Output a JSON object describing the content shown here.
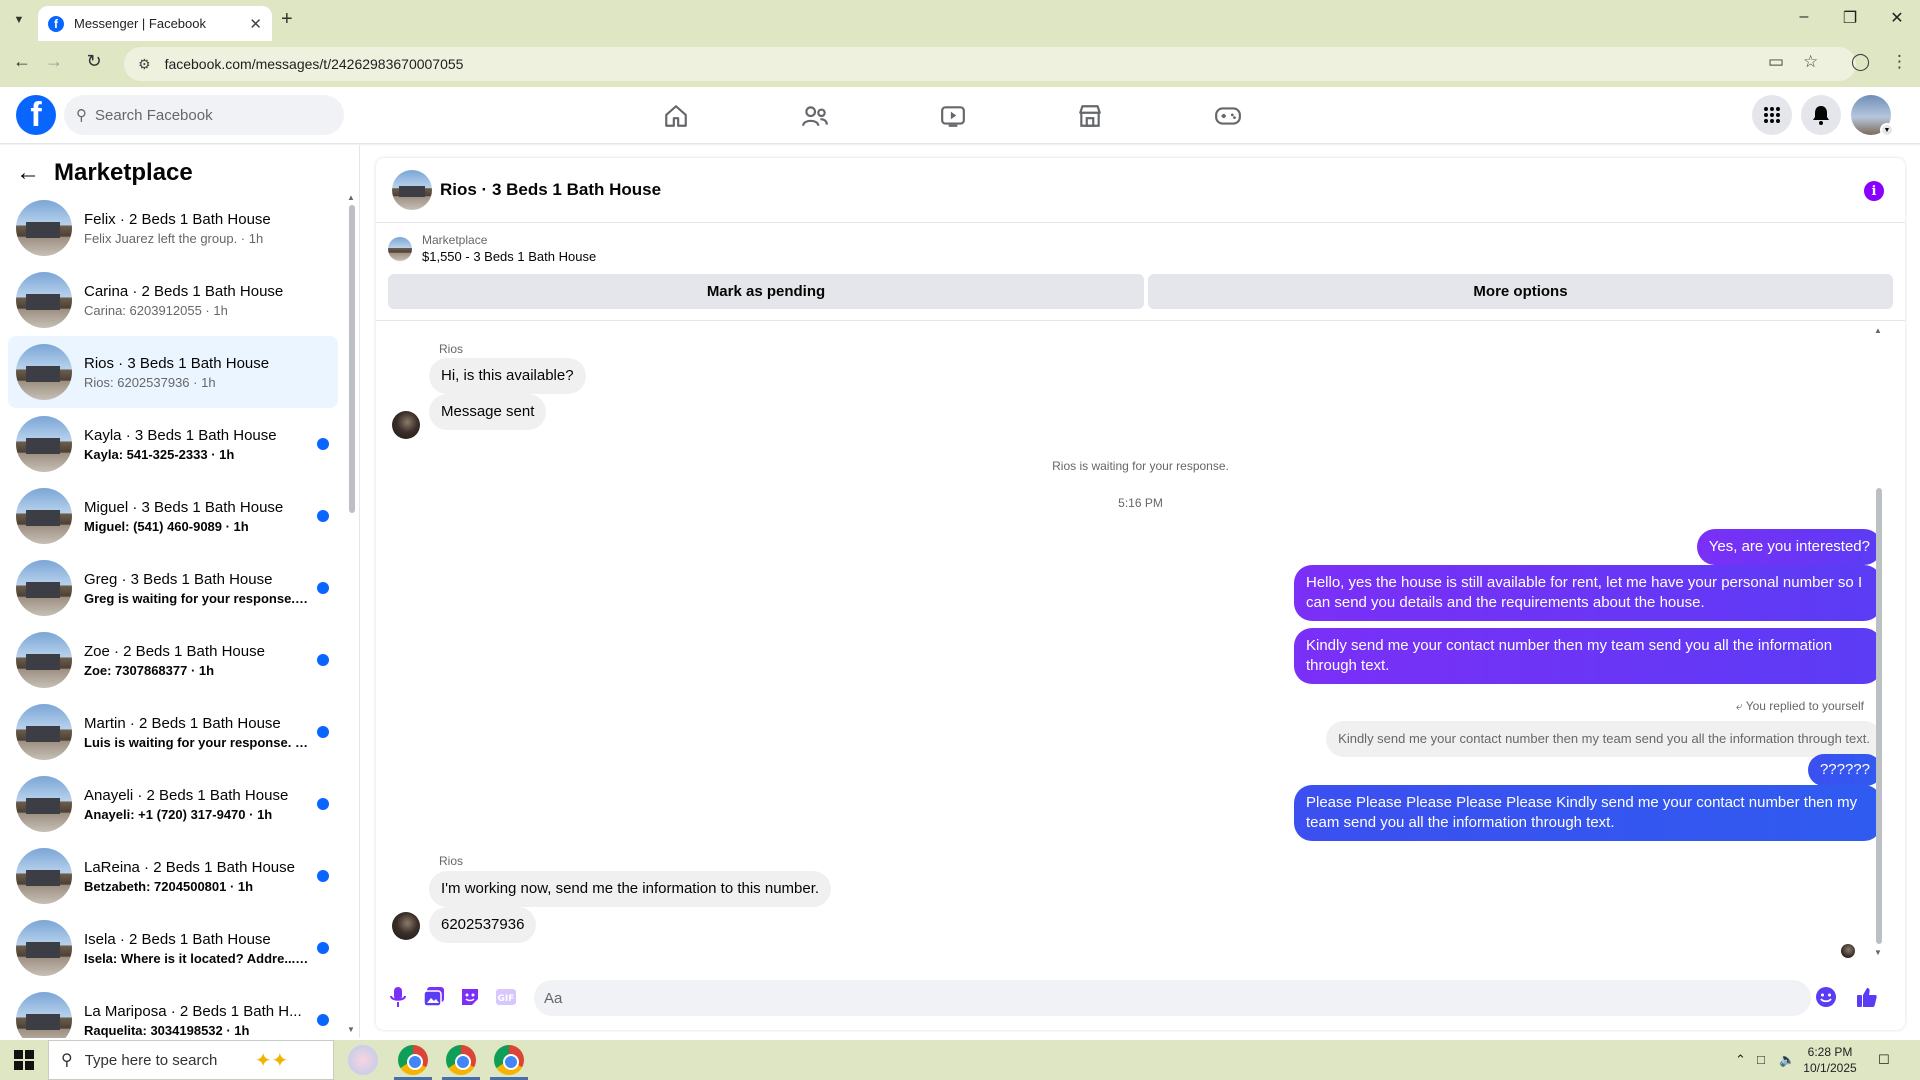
{
  "browser": {
    "tab_title": "Messenger | Facebook",
    "url": "facebook.com/messages/t/24262983670007055",
    "new_tab_glyph": "+",
    "tab_close_glyph": "✕"
  },
  "fb_header": {
    "logo_letter": "f",
    "search_placeholder": "Search Facebook",
    "nav_icons": [
      "home-icon",
      "friends-icon",
      "video-icon",
      "marketplace-icon",
      "gaming-icon"
    ],
    "right_icons": [
      "menu-grid-icon",
      "notifications-icon"
    ]
  },
  "left_panel": {
    "title": "Marketplace",
    "conversations": [
      {
        "name": "Felix · 2 Beds 1 Bath House",
        "preview": "Felix Juarez left the group. · 1h",
        "unread": false,
        "active": false
      },
      {
        "name": "Carina · 2 Beds 1 Bath House",
        "preview": "Carina: 6203912055 · 1h",
        "unread": false,
        "active": false
      },
      {
        "name": "Rios · 3 Beds 1 Bath House",
        "preview": "Rios: 6202537936 · 1h",
        "unread": false,
        "active": true
      },
      {
        "name": "Kayla · 3 Beds 1 Bath House",
        "preview": "Kayla: 541-325-2333 · 1h",
        "unread": true,
        "active": false
      },
      {
        "name": "Miguel · 3 Beds 1 Bath House",
        "preview": "Miguel: (541) 460-9089 · 1h",
        "unread": true,
        "active": false
      },
      {
        "name": "Greg · 3 Beds 1 Bath House",
        "preview": "Greg is waiting for your response. · 1h",
        "unread": true,
        "active": false
      },
      {
        "name": "Zoe · 2 Beds 1 Bath House",
        "preview": "Zoe: 7307868377 · 1h",
        "unread": true,
        "active": false
      },
      {
        "name": "Martin · 2 Beds 1 Bath House",
        "preview": "Luis is waiting for your response. · 1h",
        "unread": true,
        "active": false
      },
      {
        "name": "Anayeli · 2 Beds 1 Bath House",
        "preview": "Anayeli: +1 (720) 317-9470 · 1h",
        "unread": true,
        "active": false
      },
      {
        "name": "LaReina · 2 Beds 1 Bath House",
        "preview": "Betzabeth: 7204500801 · 1h",
        "unread": true,
        "active": false
      },
      {
        "name": "Isela · 2 Beds 1 Bath House",
        "preview": "Isela: Where is it located? Addre... · 1h",
        "unread": true,
        "active": false
      },
      {
        "name": "La Mariposa · 2 Beds 1 Bath H...",
        "preview": "Raquelita: 3034198532 · 1h",
        "unread": true,
        "active": false
      }
    ]
  },
  "chat": {
    "title": "Rios · 3 Beds 1 Bath House",
    "marketplace_label": "Marketplace",
    "listing": "$1,550 - 3 Beds 1 Bath House",
    "mark_pending": "Mark as pending",
    "more_options": "More options",
    "sender_name": "Rios",
    "msg_in_1": "Hi, is this available?",
    "msg_in_2": "Message sent",
    "waiting": "Rios is waiting for your response.",
    "time": "5:16 PM",
    "msg_out_1": "Yes, are you interested?",
    "msg_out_2": "Hello, yes the house is still available for rent, let me have your personal number so I can send you details and the requirements about the house.",
    "msg_out_3": "Kindly send me your contact number then my team send you all the information through text.",
    "replied_label": "You replied to yourself",
    "quoted": "Kindly send me your contact number then my team send you all the information through text.",
    "msg_out_4": "??????",
    "msg_out_5": "Please  Please  Please  Please  Please  Kindly send me your contact number then my team send you all the information through text.",
    "msg_in_3": "I'm working now, send me the information to this number.",
    "msg_in_4": "6202537936",
    "composer_placeholder": "Aa"
  },
  "taskbar": {
    "search_placeholder": "Type here to search",
    "time": "6:28 PM",
    "date": "10/1/2025"
  },
  "colors": {
    "fb_blue": "#0866ff",
    "outgoing_purple": "#7b2ff7",
    "outgoing_blue": "#3c4ff0",
    "active_row": "#ebf5ff",
    "chrome_bg": "#dfe6c4"
  }
}
